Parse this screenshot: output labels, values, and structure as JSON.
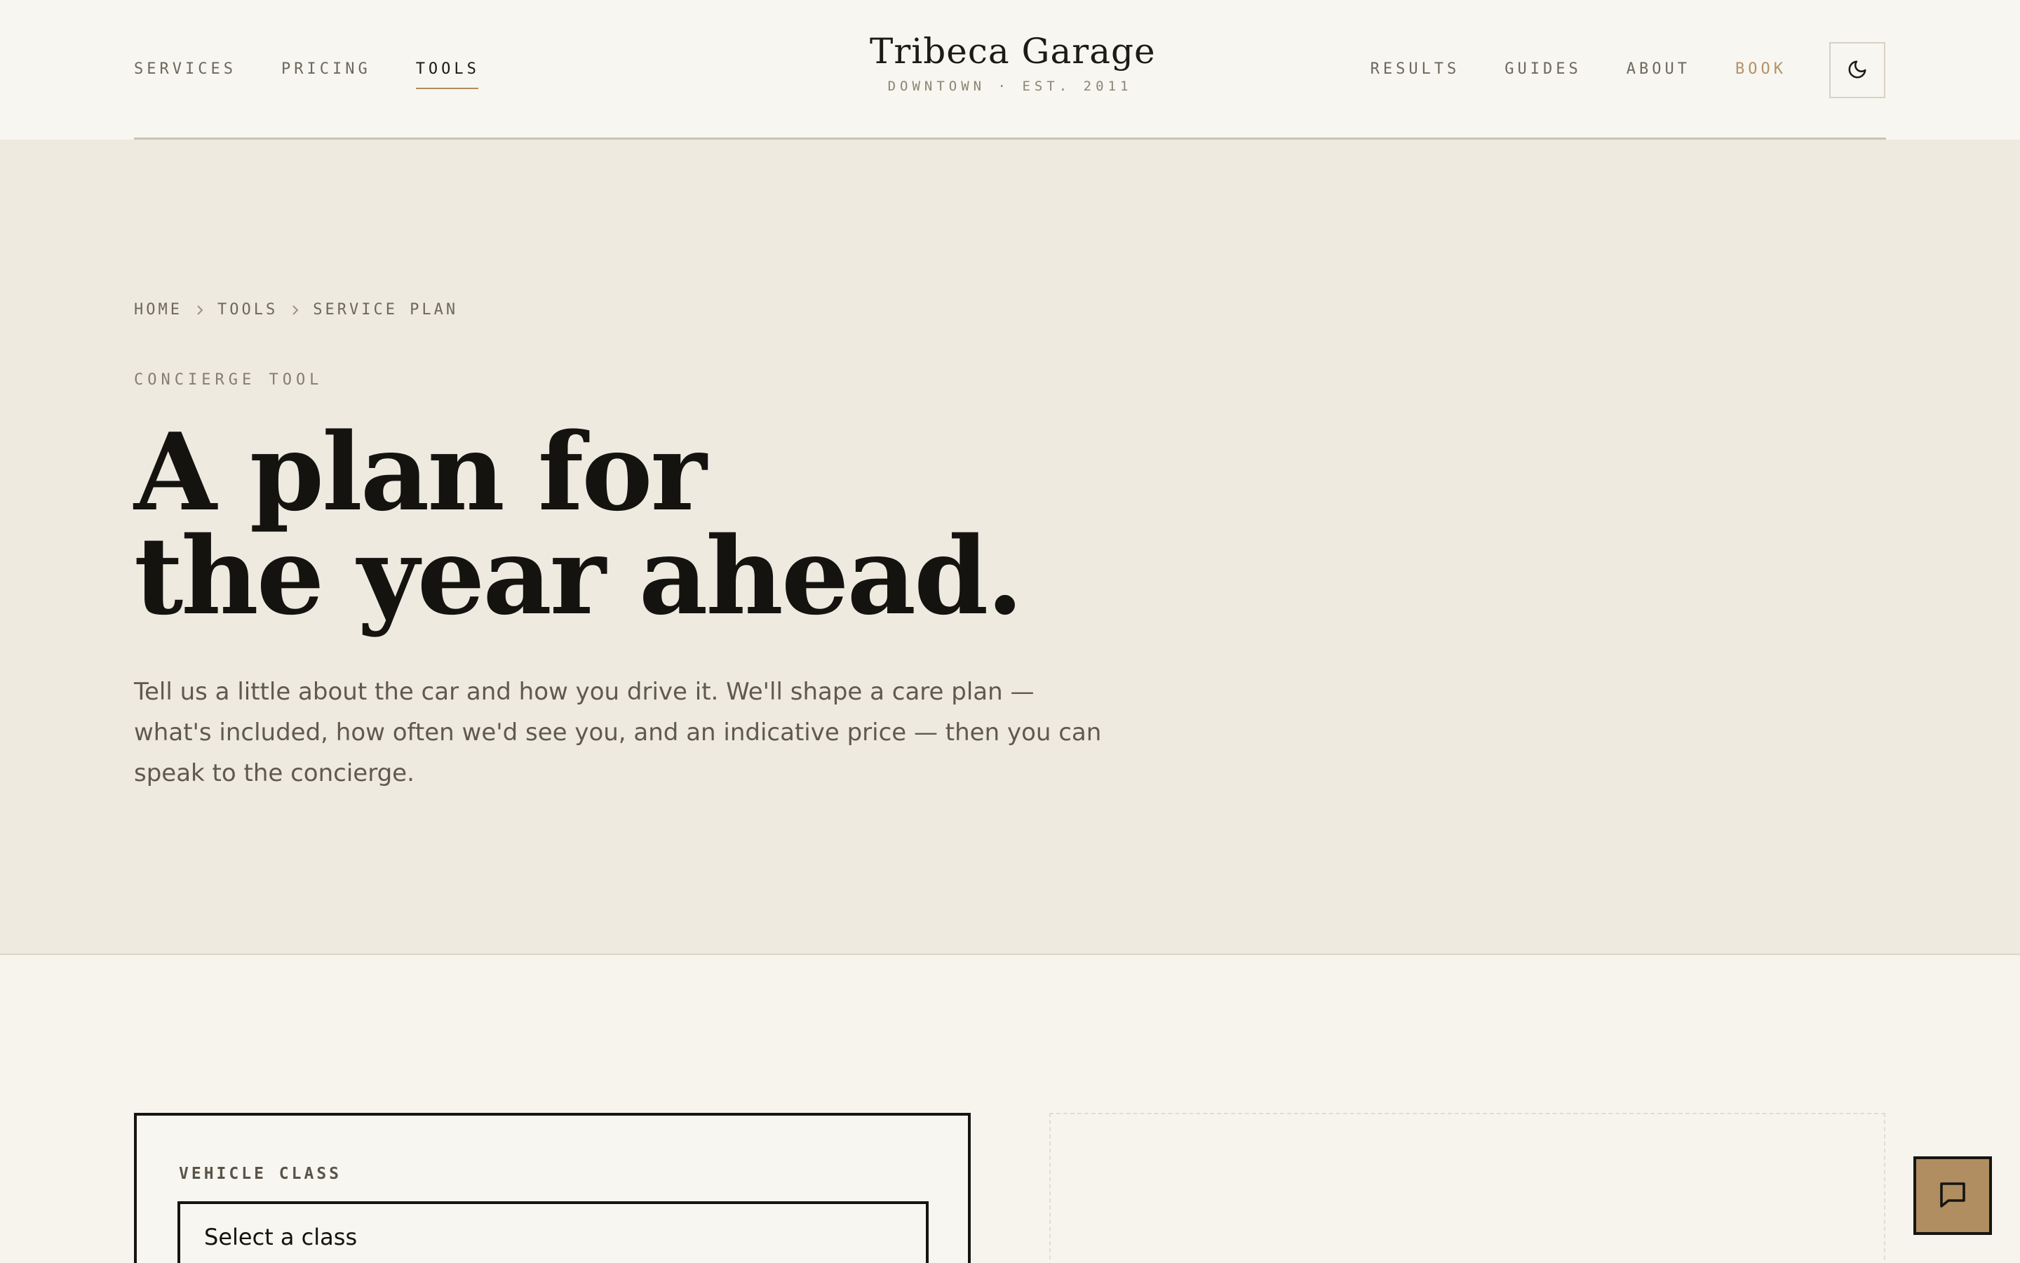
{
  "header": {
    "nav_left": [
      {
        "label": "SERVICES",
        "active": false
      },
      {
        "label": "PRICING",
        "active": false
      },
      {
        "label": "TOOLS",
        "active": true
      }
    ],
    "brand": {
      "name": "Tribeca Garage",
      "tagline": "DOWNTOWN · EST. 2011"
    },
    "nav_right": [
      {
        "label": "RESULTS"
      },
      {
        "label": "GUIDES"
      },
      {
        "label": "ABOUT"
      },
      {
        "label": "BOOK",
        "accent": true
      }
    ],
    "theme_toggle_icon": "moon-icon"
  },
  "hero": {
    "breadcrumb": [
      "HOME",
      "TOOLS",
      "SERVICE PLAN"
    ],
    "eyebrow": "CONCIERGE TOOL",
    "headline_line1": "A plan for",
    "headline_line2": "the year ahead.",
    "intro": "Tell us a little about the car and how you drive it. We'll shape a care plan — what's included, how often we'd see you, and an indicative price — then you can speak to the concierge."
  },
  "form": {
    "vehicle_class_label": "VEHICLE CLASS",
    "vehicle_class_value": "Select a class"
  },
  "chat_icon": "chat-bubble-icon",
  "colors": {
    "accent": "#b08e62",
    "hero_bg": "#eeeae0",
    "page_bg": "#f7f4ee",
    "ink": "#141310"
  }
}
